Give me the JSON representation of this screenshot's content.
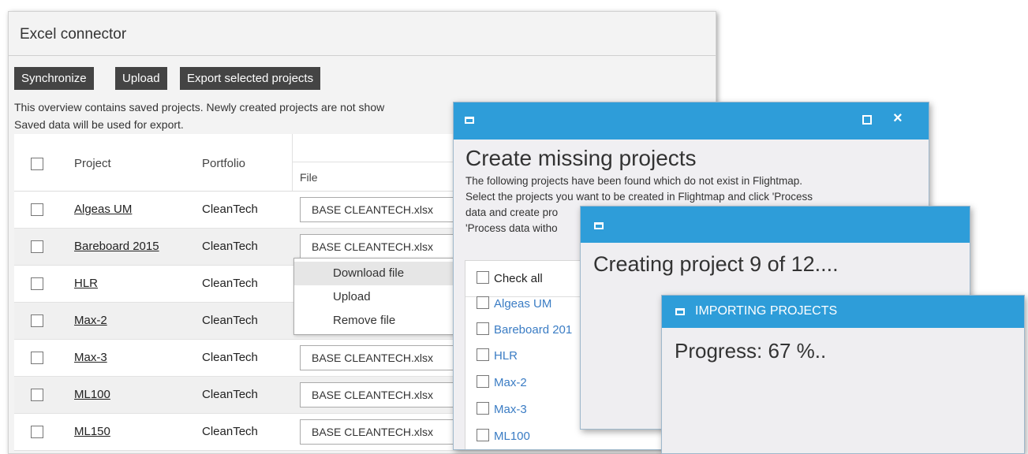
{
  "excel_connector": {
    "title": "Excel connector",
    "toolbar": {
      "synchronize": "Synchronize",
      "upload": "Upload",
      "export": "Export selected projects"
    },
    "info_line1": "This overview contains saved projects. Newly created projects are not show",
    "info_line2": "Saved data will be used for export.",
    "headers": {
      "project": "Project",
      "portfolio": "Portfolio",
      "file": "File"
    },
    "rows": [
      {
        "project": "Algeas UM",
        "portfolio": "CleanTech",
        "file": "BASE CLEANTECH.xlsx"
      },
      {
        "project": "Bareboard 2015",
        "portfolio": "CleanTech",
        "file": "BASE CLEANTECH.xlsx"
      },
      {
        "project": "HLR",
        "portfolio": "CleanTech",
        "file": ""
      },
      {
        "project": "Max-2",
        "portfolio": "CleanTech",
        "file": ""
      },
      {
        "project": "Max-3",
        "portfolio": "CleanTech",
        "file": "BASE CLEANTECH.xlsx"
      },
      {
        "project": "ML100",
        "portfolio": "CleanTech",
        "file": "BASE CLEANTECH.xlsx"
      },
      {
        "project": "ML150",
        "portfolio": "CleanTech",
        "file": "BASE CLEANTECH.xlsx"
      }
    ],
    "file_menu": [
      "Download file",
      "Upload",
      "Remove file"
    ]
  },
  "create_missing": {
    "heading": "Create missing projects",
    "desc_line1": "The following projects have been found which do not exist in Flightmap.",
    "desc_line2": "Select the projects you want to be created in Flightmap and click 'Process",
    "desc_line3": "data and create pro",
    "desc_line4": "'Process data witho",
    "check_all": "Check all",
    "projects": [
      "Algeas UM",
      "Bareboard 201",
      "HLR",
      "Max-2",
      "Max-3",
      "ML100"
    ]
  },
  "creating": {
    "status": "Creating project 9 of 12...."
  },
  "importing": {
    "title": "IMPORTING PROJECTS",
    "progress_text": "Progress: 67 %..",
    "progress": 0.67
  },
  "colors": {
    "accent": "#2e9dd9",
    "link": "#3a7cc4",
    "toolbar_button": "#444444"
  }
}
